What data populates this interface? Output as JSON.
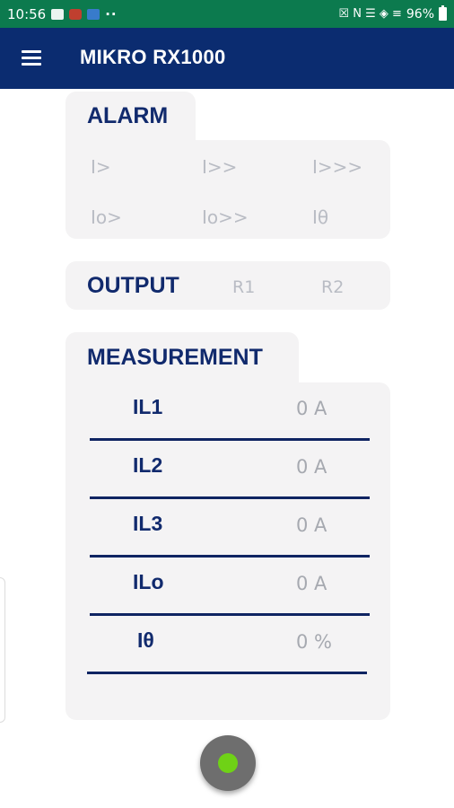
{
  "status_bar": {
    "time": "10:56",
    "dots": "··",
    "right_glyphs": "☒ N ☰ ◈ ≡",
    "battery": "96%"
  },
  "app_bar": {
    "title": "MIKRO RX1000",
    "menu_icon": "hamburger-menu-icon"
  },
  "alarm": {
    "title": "ALARM",
    "items": [
      "I>",
      "I>>",
      "I>>>",
      "Io>",
      "Io>>",
      "Iθ"
    ]
  },
  "output": {
    "title": "OUTPUT",
    "relays": [
      "R1",
      "R2"
    ]
  },
  "measurement": {
    "title": "MEASUREMENT",
    "rows": [
      {
        "name": "IL1",
        "value": "0 A"
      },
      {
        "name": "IL2",
        "value": "0 A"
      },
      {
        "name": "IL3",
        "value": "0 A"
      },
      {
        "name": "ILo",
        "value": "0 A"
      },
      {
        "name": "Iθ",
        "value": "0 %"
      }
    ]
  },
  "fab": {
    "icon": "connection-status-dot-icon",
    "status_color": "#6fd216"
  },
  "colors": {
    "status_bar": "#0c7a4e",
    "app_bar": "#0b2c70",
    "label_navy": "#112a6d",
    "inactive_gray": "#b9bcc4",
    "card_bg": "#f4f3f4"
  }
}
